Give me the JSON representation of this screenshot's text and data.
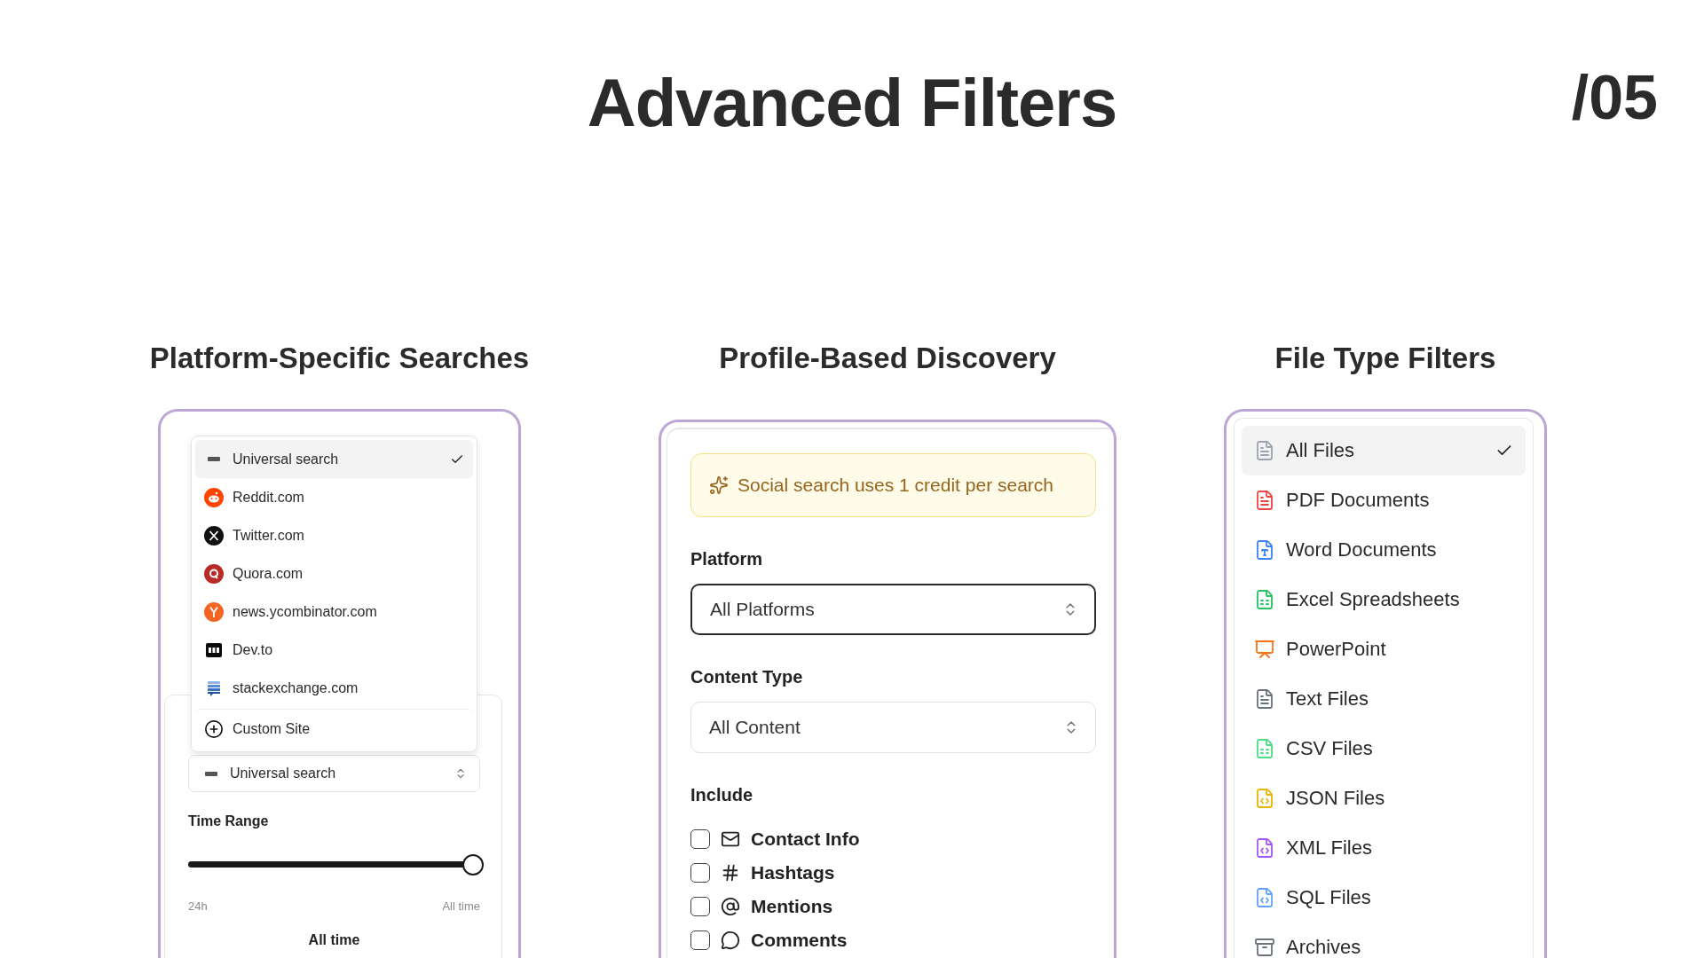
{
  "title": "Advanced Filters",
  "page_number": "/05",
  "platform_panel": {
    "heading": "Platform-Specific Searches",
    "menu_items": [
      {
        "label": "Universal search",
        "kind": "universal",
        "selected": true
      },
      {
        "label": "Reddit.com",
        "kind": "reddit",
        "selected": false
      },
      {
        "label": "Twitter.com",
        "kind": "x",
        "selected": false
      },
      {
        "label": "Quora.com",
        "kind": "quora",
        "selected": false
      },
      {
        "label": "news.ycombinator.com",
        "kind": "ycombinator",
        "selected": false
      },
      {
        "label": "Dev.to",
        "kind": "dev",
        "selected": false
      },
      {
        "label": "stackexchange.com",
        "kind": "stackexchange",
        "selected": false
      },
      {
        "label": "Custom Site",
        "kind": "custom",
        "selected": false
      }
    ],
    "select_value": "Universal search",
    "time_range": {
      "label": "Time Range",
      "level": 1,
      "min_label": "24h",
      "max_label": "All time",
      "value": "All time"
    }
  },
  "profile_panel": {
    "heading": "Profile-Based Discovery",
    "notice": "Social search uses 1 credit per search",
    "fields": [
      {
        "label": "Platform",
        "value": "All Platforms",
        "focused": true
      },
      {
        "label": "Content Type",
        "value": "All Content",
        "focused": false
      }
    ],
    "include_label": "Include",
    "include_options": [
      {
        "label": "Contact Info",
        "kind": "mail",
        "checked": false
      },
      {
        "label": "Hashtags",
        "kind": "hash",
        "checked": false
      },
      {
        "label": "Mentions",
        "kind": "at",
        "checked": false
      },
      {
        "label": "Comments",
        "kind": "comment",
        "checked": false
      }
    ]
  },
  "file_panel": {
    "heading": "File Type Filters",
    "items": [
      {
        "label": "All Files",
        "kind": "document",
        "color": "#9ca3af",
        "selected": true
      },
      {
        "label": "PDF Documents",
        "kind": "document",
        "color": "#ef4444",
        "selected": false
      },
      {
        "label": "Word Documents",
        "kind": "word",
        "color": "#3b82f6",
        "selected": false
      },
      {
        "label": "Excel Spreadsheets",
        "kind": "spreadsheet",
        "color": "#22c55e",
        "selected": false
      },
      {
        "label": "PowerPoint",
        "kind": "presentation",
        "color": "#f97316",
        "selected": false
      },
      {
        "label": "Text Files",
        "kind": "document",
        "color": "#6b7280",
        "selected": false
      },
      {
        "label": "CSV Files",
        "kind": "spreadsheet",
        "color": "#4ade80",
        "selected": false
      },
      {
        "label": "JSON Files",
        "kind": "code",
        "color": "#eab308",
        "selected": false
      },
      {
        "label": "XML Files",
        "kind": "code",
        "color": "#a855f7",
        "selected": false
      },
      {
        "label": "SQL Files",
        "kind": "code",
        "color": "#60a5fa",
        "selected": false
      },
      {
        "label": "Archives",
        "kind": "archive",
        "color": "#6b7280",
        "selected": false
      }
    ]
  }
}
